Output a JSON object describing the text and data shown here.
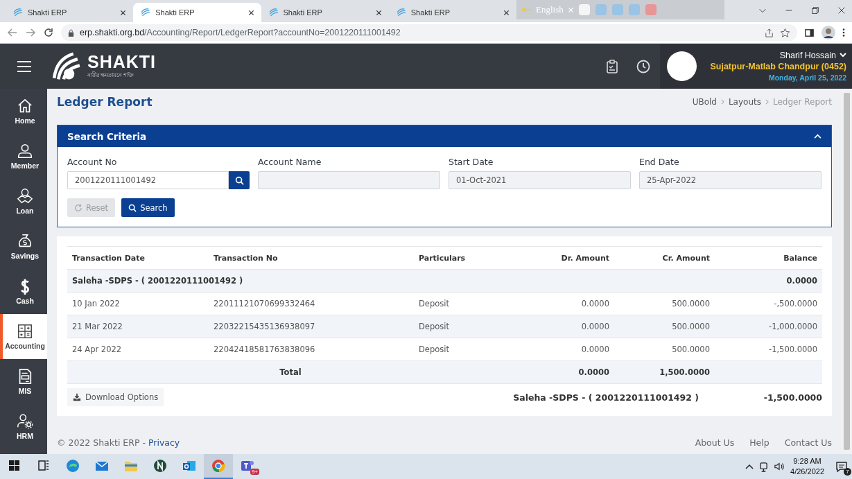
{
  "browser": {
    "tabs": [
      {
        "title": "Shakti ERP",
        "selected": false
      },
      {
        "title": "Shakti ERP",
        "selected": true
      },
      {
        "title": "Shakti ERP",
        "selected": false
      },
      {
        "title": "Shakti ERP",
        "selected": false
      }
    ],
    "overlay": {
      "language": "English"
    },
    "address": {
      "host": "erp.shakti.org.bd",
      "path": "/Accounting/Report/LedgerReport?accountNo=2001220111001492"
    }
  },
  "header": {
    "brand": "SHAKTI",
    "tagline": "নারীর ক্ষমতায়নে শক্তি",
    "user": "Sharif Hossain",
    "branch": "Sujatpur-Matlab Chandpur (0452)",
    "date": "Monday, April 25, 2022"
  },
  "sidebar": {
    "items": [
      {
        "label": "Home",
        "kind": "home",
        "selected": false
      },
      {
        "label": "Member",
        "kind": "member",
        "selected": false
      },
      {
        "label": "Loan",
        "kind": "loan",
        "selected": false
      },
      {
        "label": "Savings",
        "kind": "savings",
        "selected": false
      },
      {
        "label": "Cash",
        "kind": "cash",
        "selected": false
      },
      {
        "label": "Accounting",
        "kind": "accounting",
        "selected": true
      },
      {
        "label": "MIS",
        "kind": "mis",
        "selected": false
      },
      {
        "label": "HRM",
        "kind": "hrm",
        "selected": false
      }
    ]
  },
  "page": {
    "title": "Ledger Report",
    "breadcrumb": [
      {
        "label": "UBold",
        "current": false
      },
      {
        "label": "Layouts",
        "current": false
      },
      {
        "label": "Ledger Report",
        "current": true
      }
    ]
  },
  "search": {
    "title": "Search Criteria",
    "expanded": true,
    "fields": [
      {
        "label": "Account No",
        "value": "2001220111001492",
        "kind": "lookup",
        "disabled": false
      },
      {
        "label": "Account Name",
        "kind": "text",
        "disabled": true
      },
      {
        "label": "Start Date",
        "value": "01-Oct-2021",
        "kind": "text",
        "disabled": true
      },
      {
        "label": "End Date",
        "value": "25-Apr-2022",
        "kind": "text",
        "disabled": true
      }
    ],
    "buttons": [
      {
        "label": "Reset",
        "kind": "reset",
        "disabled": true
      },
      {
        "label": "Search",
        "kind": "search",
        "disabled": false
      }
    ]
  },
  "table": {
    "columns": [
      "Transaction Date",
      "Transaction No",
      "Particulars",
      "Dr. Amount",
      "Cr. Amount",
      "Balance"
    ],
    "rows": [
      {
        "kind": "group",
        "label": "Saleha -SDPS - ( 2001220111001492 )",
        "balance": "0.0000"
      },
      {
        "kind": "entry",
        "cells": [
          "10 Jan 2022",
          "22011121070699332464",
          "Deposit",
          "0.0000",
          "500.0000",
          "-,500.0000"
        ]
      },
      {
        "kind": "entry",
        "cells": [
          "21 Mar 2022",
          "22032215435136938097",
          "Deposit",
          "0.0000",
          "500.0000",
          "-1,000.0000"
        ]
      },
      {
        "kind": "entry",
        "cells": [
          "24 Apr 2022",
          "22042418581763838096",
          "Deposit",
          "0.0000",
          "500.0000",
          "-1,500.0000"
        ]
      },
      {
        "kind": "total",
        "label": "Total",
        "dr": "0.0000",
        "cr": "1,500.0000"
      }
    ],
    "download": "Download Options",
    "summary": {
      "account": "Saleha -SDPS - ( 2001220111001492 )",
      "balance": "-1,500.0000"
    }
  },
  "footer": {
    "copyright": "© 2022 Shakti ERP - ",
    "privacy": "Privacy",
    "links": [
      "About Us",
      "Help",
      "Contact Us"
    ]
  },
  "taskbar": {
    "apps": [
      {
        "kind": "start",
        "selected": false
      },
      {
        "kind": "taskview",
        "selected": false
      },
      {
        "kind": "edge",
        "selected": false
      },
      {
        "kind": "mail",
        "selected": false
      },
      {
        "kind": "files",
        "selected": false
      },
      {
        "kind": "ncircle",
        "selected": false
      },
      {
        "kind": "outlook",
        "selected": false
      },
      {
        "kind": "chrome",
        "selected": true
      },
      {
        "kind": "teams",
        "selected": false,
        "badge": "9+"
      }
    ],
    "time": "9:28 AM",
    "date": "4/26/2022",
    "notifications": "7"
  }
}
